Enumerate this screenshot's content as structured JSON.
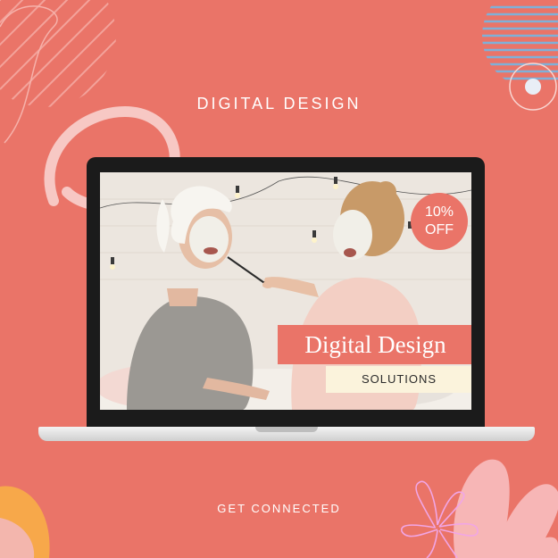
{
  "colors": {
    "background": "#ea7468",
    "accent": "#ea7468",
    "cream": "#fbf3dc",
    "light_pink": "#f7b6b6",
    "blue_stripe": "#7fb0d8"
  },
  "header": {
    "title": "DIGITAL DESIGN"
  },
  "promo": {
    "badge_line1": "10%",
    "badge_line2": "OFF",
    "title": "Digital Design",
    "subtitle": "SOLUTIONS"
  },
  "footer": {
    "text": "GET CONNECTED"
  },
  "icons": [
    "laptop-icon",
    "flower-icon",
    "circle-decoration",
    "stripe-decoration"
  ]
}
